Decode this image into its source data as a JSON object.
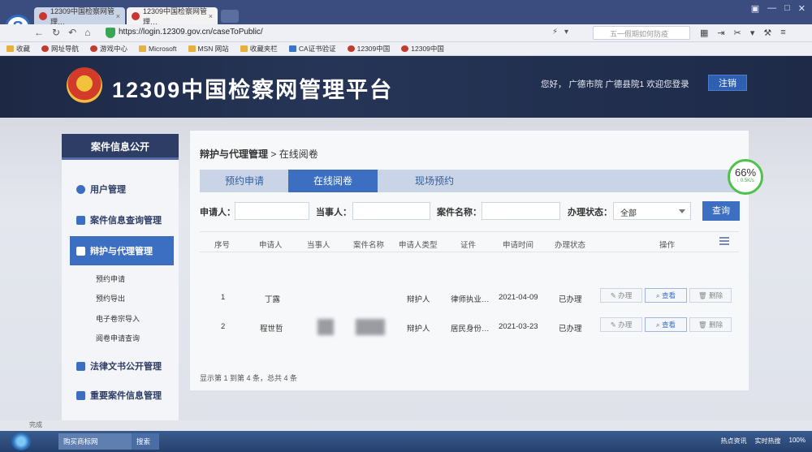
{
  "browser": {
    "tabs": [
      {
        "title": "12309中国检察网管理…",
        "close": "×"
      },
      {
        "title": "12309中国检察网管理…",
        "close": "×"
      }
    ],
    "logo_letter": "S",
    "url": "https://login.12309.gov.cn/caseToPublic/",
    "search_placeholder": "五一假期如何防疫",
    "bookmarks": [
      "收藏",
      "网址导航",
      "游戏中心",
      "Microsoft",
      "MSN 网站",
      "收藏夹栏",
      "CA证书验证",
      "12309中国",
      "12309中国"
    ]
  },
  "site": {
    "title": "12309中国检察网管理平台",
    "greeting": "您好， 广德市院 广德县院1 欢迎您登录",
    "logout": "注销"
  },
  "sidebar": {
    "header": "案件信息公开",
    "items": [
      {
        "label": "用户管理"
      },
      {
        "label": "案件信息查询管理"
      },
      {
        "label": "辩护与代理管理"
      },
      {
        "label": "法律文书公开管理"
      },
      {
        "label": "重要案件信息管理"
      }
    ],
    "sub_items": [
      "预约申请",
      "预约导出",
      "电子卷宗导入",
      "阅卷申请查询"
    ]
  },
  "breadcrumb": {
    "parent": "辩护与代理管理",
    "separator": " > ",
    "current": "在线阅卷"
  },
  "tabs": [
    "预约申请",
    "在线阅卷",
    "现场预约"
  ],
  "filters": {
    "applicant_label": "申请人：",
    "party_label": "当事人：",
    "case_label": "案件名称：",
    "status_label": "办理状态：",
    "status_value": "全部",
    "query_button": "查询"
  },
  "table": {
    "columns": [
      "序号",
      "申请人",
      "当事人",
      "案件名称",
      "申请人类型",
      "证件",
      "申请时间",
      "办理状态",
      "操作"
    ],
    "rows": [
      {
        "index": "1",
        "applicant": "丁露",
        "type": "辩护人",
        "cert": "律师执业…",
        "date": "2021-04-09",
        "status": "已办理"
      },
      {
        "index": "2",
        "applicant": "程世哲",
        "type": "辩护人",
        "cert": "居民身份…",
        "date": "2021-03-23",
        "status": "已办理"
      }
    ],
    "actions": {
      "handle": "办理",
      "view": "查看",
      "delete": "删除"
    },
    "footer": "显示第 1 到第 4 条，总共 4 条"
  },
  "speed_widget": {
    "percent": "66%",
    "rate": "↓ 0.5K/s"
  },
  "status_bar": "完成",
  "taskbar": {
    "item1": "购买商标网",
    "item2": "搜索一下"
  },
  "tray": [
    "热点资讯",
    "实时热搜",
    "100%"
  ]
}
